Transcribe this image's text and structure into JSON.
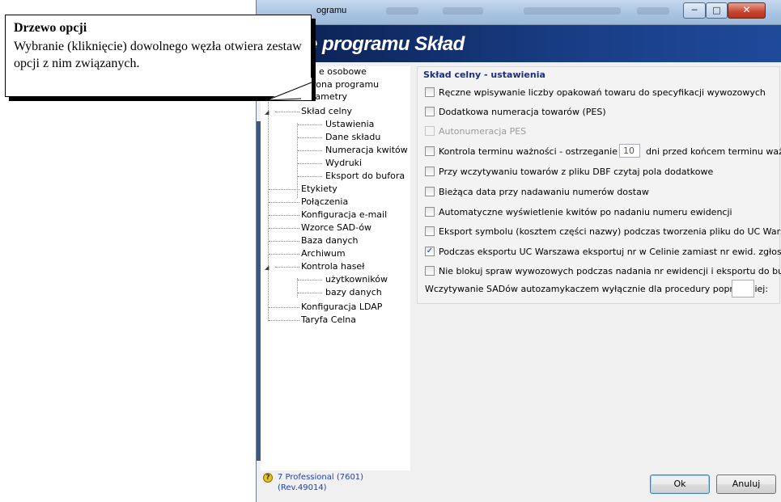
{
  "window": {
    "title": "ogramu",
    "banner": "e programu Skład"
  },
  "callout": {
    "title": "Drzewo opcji",
    "body": "Wybranie (kliknięcie) dowolnego węzła otwiera zestaw opcji  z nim związanych."
  },
  "tree": {
    "items": [
      {
        "label": "e osobowe"
      },
      {
        "label": "rona programu"
      },
      {
        "label": "Parametry"
      },
      {
        "label": "Skład celny"
      },
      {
        "label": "Ustawienia"
      },
      {
        "label": "Dane składu"
      },
      {
        "label": "Numeracja kwitów"
      },
      {
        "label": "Wydruki"
      },
      {
        "label": "Eksport do bufora"
      },
      {
        "label": "Etykiety"
      },
      {
        "label": "Połączenia"
      },
      {
        "label": "Konfiguracja e-mail"
      },
      {
        "label": "Wzorce SAD-ów"
      },
      {
        "label": "Baza danych"
      },
      {
        "label": "Archiwum"
      },
      {
        "label": "Kontrola haseł"
      },
      {
        "label": "użytkowników"
      },
      {
        "label": "bazy danych"
      },
      {
        "label": "Konfiguracja LDAP"
      },
      {
        "label": "Taryfa Celna"
      }
    ]
  },
  "status": {
    "line1": "7 Professional (7601)",
    "line2": "(Rev.49014)"
  },
  "settings": {
    "section_title": "Skład celny - ustawienia",
    "options": [
      {
        "label": "Ręczne wpisywanie liczby opakowań towaru do specyfikacji wywozowych",
        "checked": false,
        "disabled": false
      },
      {
        "label": "Dodatkowa numeracja towarów (PES)",
        "checked": false,
        "disabled": false
      },
      {
        "label": "Autonumeracja PES",
        "checked": false,
        "disabled": true
      },
      {
        "label": "Kontrola terminu ważności - ostrzeganie na",
        "checked": false,
        "disabled": false
      },
      {
        "label": "Przy wczytywaniu towarów z pliku DBF czytaj pola dodatkowe",
        "checked": false,
        "disabled": false
      },
      {
        "label": "Bieżąca data przy nadawaniu numerów dostaw",
        "checked": false,
        "disabled": false
      },
      {
        "label": "Automatyczne wyświetlenie kwitów po nadaniu numeru ewidencji",
        "checked": false,
        "disabled": false
      },
      {
        "label": "Eksport symbolu (kosztem części nazwy) podczas tworzenia pliku do UC Warszawa",
        "checked": false,
        "disabled": false
      },
      {
        "label": "Podczas eksportu UC Warszawa eksportuj nr w Celinie zamiast nr  ewid. zgłoszenia",
        "checked": true,
        "disabled": false
      },
      {
        "label": "Nie blokuj spraw wywozowych podczas nadania nr ewidencji i eksportu do bufora",
        "checked": false,
        "disabled": false
      }
    ],
    "expiry_days_value": "10",
    "expiry_suffix": "dni przed końcem terminu ważności",
    "sad_label": "Wczytywanie SADów autozamykaczem wyłącznie dla procedury poprzedniej:",
    "sad_value": ""
  },
  "buttons": {
    "ok_label": "Ok",
    "cancel_label": "Anuluj"
  },
  "colors": {
    "banner_bg": "#193d85",
    "section_title": "#1a2f7a",
    "status_text": "#1e3fae"
  }
}
